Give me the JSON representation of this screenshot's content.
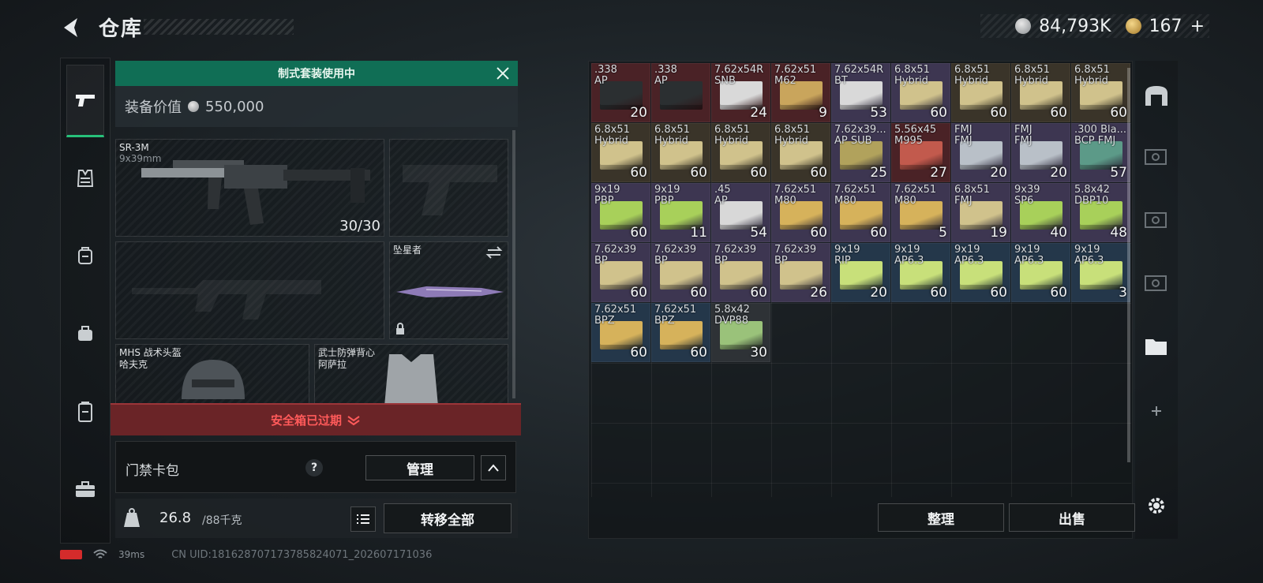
{
  "header": {
    "title": "仓库"
  },
  "currency": {
    "money": "84,793K",
    "coins": "167",
    "add_label": "+"
  },
  "loadout": {
    "banner": "制式套装使用中",
    "value_label": "装备价值",
    "value": "550,000",
    "primary": {
      "name": "SR-3M",
      "caliber": "9x39mm",
      "ammo": "30/30"
    },
    "melee": {
      "name": "坠星者"
    },
    "helmet": {
      "line1": "MHS 战术头盔",
      "line2": "哈夫克"
    },
    "vest": {
      "line1": "武士防弹背心",
      "line2": "阿萨拉"
    },
    "safe_box": "安全箱已过期",
    "keycard": {
      "label": "门禁卡包",
      "help": "?",
      "manage": "管理"
    },
    "weight": {
      "value": "26.8",
      "max": "/88千克"
    },
    "transfer_all": "转移全部"
  },
  "stash": {
    "items": [
      {
        "name": ".338\nAP",
        "qty": "20",
        "bg": "#4a2226",
        "box": "#2b2f31"
      },
      {
        "name": ".338\nAP",
        "qty": "",
        "bg": "#4a2226",
        "box": "#2b2f31"
      },
      {
        "name": "7.62x54R\nSNB",
        "qty": "24",
        "bg": "#4a2226",
        "box": "#d9d9d9"
      },
      {
        "name": "7.62x51\nM62",
        "qty": "9",
        "bg": "#4a2226",
        "box": "#c9a55c"
      },
      {
        "name": "7.62x54R\nBT",
        "qty": "53",
        "bg": "#3d3651",
        "box": "#d9d9d9"
      },
      {
        "name": "6.8x51\nHybrid",
        "qty": "60",
        "bg": "#3d3651",
        "box": "#d0c28c"
      },
      {
        "name": "6.8x51\nHybrid",
        "qty": "60",
        "bg": "#3a3429",
        "box": "#d0c28c"
      },
      {
        "name": "6.8x51\nHybrid",
        "qty": "60",
        "bg": "#3a3429",
        "box": "#d0c28c"
      },
      {
        "name": "6.8x51\nHybrid",
        "qty": "60",
        "bg": "#3a3429",
        "box": "#d0c28c"
      },
      {
        "name": "6.8x51\nHybrid",
        "qty": "60",
        "bg": "#3a3429",
        "box": "#d0c28c"
      },
      {
        "name": "6.8x51\nHybrid",
        "qty": "60",
        "bg": "#3a3429",
        "box": "#d0c28c"
      },
      {
        "name": "6.8x51\nHybrid",
        "qty": "60",
        "bg": "#3a3429",
        "box": "#d0c28c"
      },
      {
        "name": "6.8x51\nHybrid",
        "qty": "60",
        "bg": "#3a3429",
        "box": "#d0c28c"
      },
      {
        "name": "7.62x39...\nAP SUB",
        "qty": "25",
        "bg": "#3d3651",
        "box": "#b1a25c"
      },
      {
        "name": "5.56x45\nM995",
        "qty": "27",
        "bg": "#4a2226",
        "box": "#c25a4d"
      },
      {
        "name": "FMJ\nFMJ",
        "qty": "20",
        "bg": "#3d3651",
        "box": "#b9c0c8"
      },
      {
        "name": "FMJ\nFMJ",
        "qty": "20",
        "bg": "#3d3651",
        "box": "#b9c0c8"
      },
      {
        "name": ".300 Bla...\nBCP FMJ",
        "qty": "57",
        "bg": "#3d3651",
        "box": "#5c9a88"
      },
      {
        "name": "9x19\nPBP",
        "qty": "60",
        "bg": "#3d3651",
        "box": "#a8d05a"
      },
      {
        "name": "9x19\nPBP",
        "qty": "11",
        "bg": "#3d3651",
        "box": "#a8d05a"
      },
      {
        "name": ".45\nAP",
        "qty": "54",
        "bg": "#3d3651",
        "box": "#d8d8d8"
      },
      {
        "name": "7.62x51\nM80",
        "qty": "60",
        "bg": "#3d3651",
        "box": "#d6b25b"
      },
      {
        "name": "7.62x51\nM80",
        "qty": "60",
        "bg": "#3d3651",
        "box": "#d6b25b"
      },
      {
        "name": "7.62x51\nM80",
        "qty": "5",
        "bg": "#3d3651",
        "box": "#d6b25b"
      },
      {
        "name": "6.8x51\nFMJ",
        "qty": "19",
        "bg": "#3d3651",
        "box": "#d0c28c"
      },
      {
        "name": "9x39\nSP6",
        "qty": "40",
        "bg": "#3d3651",
        "box": "#a8d05a"
      },
      {
        "name": "5.8x42\nDBP10",
        "qty": "48",
        "bg": "#3d3651",
        "box": "#a8d05a"
      },
      {
        "name": "7.62x39\nBP",
        "qty": "60",
        "bg": "#3d3651",
        "box": "#d0c28c"
      },
      {
        "name": "7.62x39\nBP",
        "qty": "60",
        "bg": "#3d3651",
        "box": "#d0c28c"
      },
      {
        "name": "7.62x39\nBP",
        "qty": "60",
        "bg": "#3d3651",
        "box": "#d0c28c"
      },
      {
        "name": "7.62x39\nBP",
        "qty": "26",
        "bg": "#3d3651",
        "box": "#d0c28c"
      },
      {
        "name": "9x19\nRIP",
        "qty": "20",
        "bg": "#24374a",
        "box": "#c8e07a"
      },
      {
        "name": "9x19\nAP6.3",
        "qty": "60",
        "bg": "#24374a",
        "box": "#c8e07a"
      },
      {
        "name": "9x19\nAP6.3",
        "qty": "60",
        "bg": "#24374a",
        "box": "#c8e07a"
      },
      {
        "name": "9x19\nAP6.3",
        "qty": "60",
        "bg": "#24374a",
        "box": "#c8e07a"
      },
      {
        "name": "9x19\nAP6.3",
        "qty": "3",
        "bg": "#24374a",
        "box": "#c8e07a"
      },
      {
        "name": "7.62x51\nBPZ",
        "qty": "60",
        "bg": "#24374a",
        "box": "#d6b25b"
      },
      {
        "name": "7.62x51\nBPZ",
        "qty": "60",
        "bg": "#24374a",
        "box": "#d6b25b"
      },
      {
        "name": "5.8x42\nDVP88",
        "qty": "30",
        "bg": "#2e3236",
        "box": "#9ac27a"
      }
    ],
    "sort": "整理",
    "sell": "出售"
  },
  "status": {
    "ping": "39ms",
    "uid": "CN UID:181628707173785824071_202607171036"
  }
}
